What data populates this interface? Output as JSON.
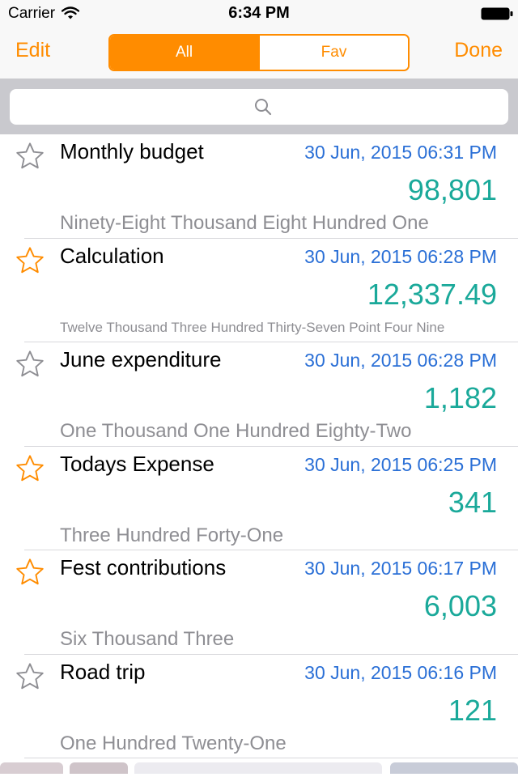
{
  "status_bar": {
    "carrier": "Carrier",
    "time": "6:34 PM"
  },
  "nav": {
    "edit_label": "Edit",
    "done_label": "Done",
    "segments": [
      "All",
      "Fav"
    ],
    "selected_segment": "All"
  },
  "search": {
    "icon": "search-icon"
  },
  "colors": {
    "accent": "#ff8c00",
    "date": "#2a6fd6",
    "value": "#1aa99a",
    "words": "#8e8e93"
  },
  "items": [
    {
      "title": "Monthly budget",
      "date": "30 Jun, 2015 06:31 PM",
      "value": "98,801",
      "words": "Ninety-Eight Thousand Eight Hundred One",
      "favorite": false
    },
    {
      "title": "Calculation",
      "date": "30 Jun, 2015 06:28 PM",
      "value": "12,337.49",
      "words": "Twelve Thousand Three Hundred Thirty-Seven Point Four Nine",
      "favorite": true
    },
    {
      "title": "June expenditure",
      "date": "30 Jun, 2015 06:28 PM",
      "value": "1,182",
      "words": "One Thousand One Hundred Eighty-Two",
      "favorite": false
    },
    {
      "title": "Todays Expense",
      "date": "30 Jun, 2015 06:25 PM",
      "value": "341",
      "words": "Three Hundred Forty-One",
      "favorite": true
    },
    {
      "title": "Fest contributions",
      "date": "30 Jun, 2015 06:17 PM",
      "value": "6,003",
      "words": "Six Thousand Three",
      "favorite": true
    },
    {
      "title": "Road trip",
      "date": "30 Jun, 2015 06:16 PM",
      "value": "121",
      "words": "One Hundred Twenty-One",
      "favorite": false
    }
  ]
}
